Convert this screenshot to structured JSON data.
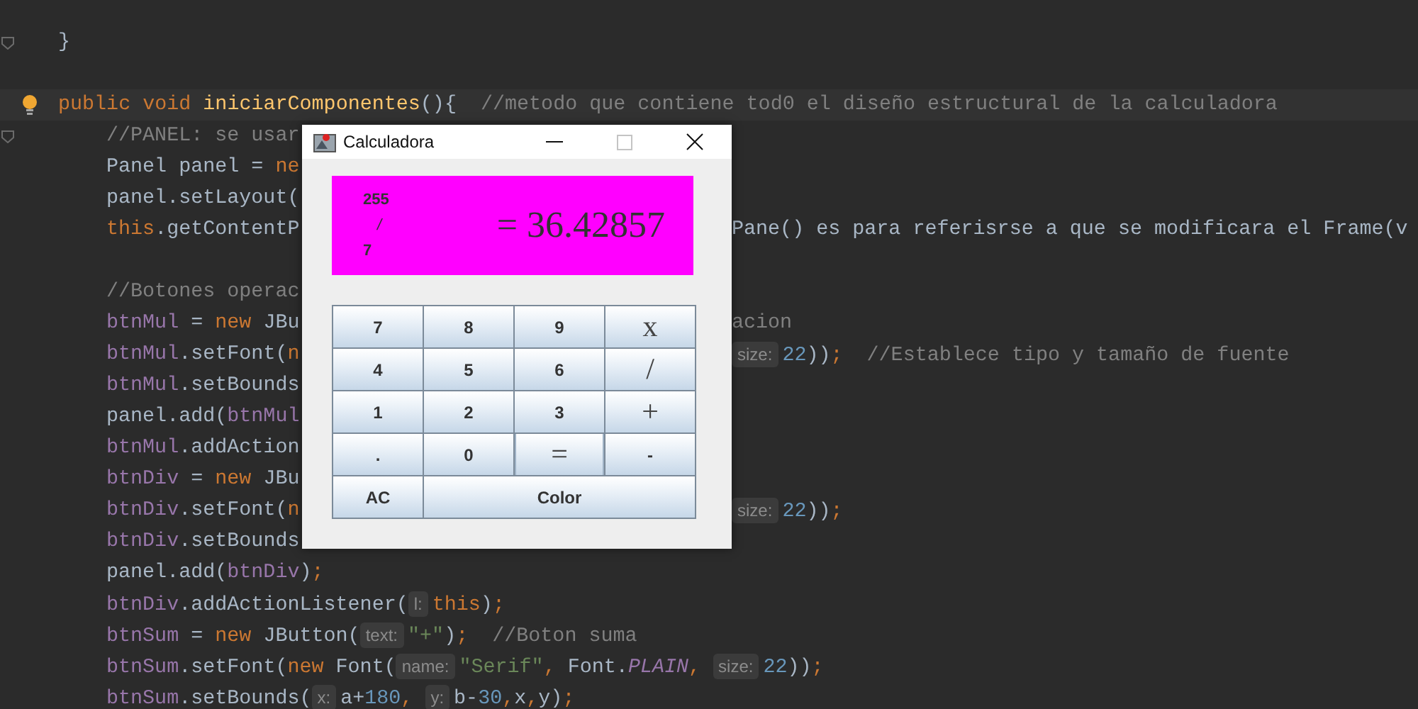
{
  "editor": {
    "lines": [
      {
        "kind": "blank"
      },
      {
        "kind": "code",
        "gutter": {
          "kind": "fold"
        },
        "segs": [
          {
            "kind": "plain",
            "t": "}"
          }
        ]
      },
      {
        "kind": "blank"
      },
      {
        "kind": "code",
        "current": true,
        "gutter": {
          "kind": "bulb"
        },
        "segs": [
          {
            "kind": "kw",
            "t": "public void "
          },
          {
            "kind": "method",
            "t": "iniciarComponentes"
          },
          {
            "kind": "plain",
            "t": "(){"
          },
          {
            "kind": "comment",
            "t": "//metodo que contiene tod0 el diseño estructural de la calculadora"
          }
        ],
        "children": [
          {
            "kind": "code",
            "gutter": {
              "kind": "fold"
            },
            "segs": [
              {
                "kind": "comment",
                "t": "//PANEL: se usar"
              }
            ]
          },
          {
            "kind": "code",
            "segs": [
              {
                "kind": "plain",
                "t": "Panel panel = "
              },
              {
                "kind": "kw",
                "t": "ne"
              }
            ]
          },
          {
            "kind": "code",
            "segs": [
              {
                "kind": "plain",
                "t": "panel.setLayout("
              }
            ]
          },
          {
            "kind": "code",
            "segs": [
              {
                "kind": "kw",
                "t": "this"
              },
              {
                "kind": "plain",
                "t": ".getContentP"
              }
            ],
            "right": [
              {
                "kind": "plain",
                "t": "Pane() es para referisrse a que se modificara el Frame(v"
              }
            ]
          },
          {
            "kind": "blank"
          },
          {
            "kind": "code",
            "segs": [
              {
                "kind": "comment",
                "t": "//Botones operac"
              }
            ]
          },
          {
            "kind": "code",
            "segs": [
              {
                "kind": "field",
                "t": "btnMul"
              },
              {
                "kind": "plain",
                "t": " = "
              },
              {
                "kind": "kw",
                "t": "new "
              },
              {
                "kind": "plain",
                "t": "JBu"
              }
            ],
            "right": [
              {
                "kind": "comment",
                "t": "acion"
              }
            ]
          },
          {
            "kind": "code",
            "segs": [
              {
                "kind": "field",
                "t": "btnMul"
              },
              {
                "kind": "plain",
                "t": ".setFont("
              },
              {
                "kind": "kw",
                "t": "n"
              }
            ],
            "right": [
              {
                "kind": "hint",
                "t": "size:"
              },
              {
                "kind": "num",
                "t": "22"
              },
              {
                "kind": "plain",
                "t": "))"
              },
              {
                "kind": "kw",
                "t": ";"
              },
              {
                "kind": "comment",
                "t": "//Establece tipo y tamaño de fuente"
              }
            ]
          },
          {
            "kind": "code",
            "segs": [
              {
                "kind": "field",
                "t": "btnMul"
              },
              {
                "kind": "plain",
                "t": ".setBounds"
              }
            ]
          },
          {
            "kind": "code",
            "segs": [
              {
                "kind": "plain",
                "t": "panel.add("
              },
              {
                "kind": "field",
                "t": "btnMul"
              }
            ]
          },
          {
            "kind": "code",
            "segs": [
              {
                "kind": "field",
                "t": "btnMul"
              },
              {
                "kind": "plain",
                "t": ".addAction"
              }
            ]
          },
          {
            "kind": "code",
            "segs": [
              {
                "kind": "field",
                "t": "btnDiv"
              },
              {
                "kind": "plain",
                "t": " = "
              },
              {
                "kind": "kw",
                "t": "new "
              },
              {
                "kind": "plain",
                "t": "JBu"
              }
            ]
          },
          {
            "kind": "code",
            "segs": [
              {
                "kind": "field",
                "t": "btnDiv"
              },
              {
                "kind": "plain",
                "t": ".setFont("
              },
              {
                "kind": "kw",
                "t": "n"
              }
            ],
            "right": [
              {
                "kind": "hint",
                "t": "size:"
              },
              {
                "kind": "num",
                "t": "22"
              },
              {
                "kind": "plain",
                "t": "))"
              },
              {
                "kind": "kw",
                "t": ";"
              }
            ]
          },
          {
            "kind": "code",
            "segs": [
              {
                "kind": "field",
                "t": "btnDiv"
              },
              {
                "kind": "plain",
                "t": ".setBounds"
              }
            ]
          },
          {
            "kind": "code",
            "segs": [
              {
                "kind": "plain",
                "t": "panel.add("
              },
              {
                "kind": "field",
                "t": "btnDiv"
              },
              {
                "kind": "plain",
                "t": ")"
              },
              {
                "kind": "kw",
                "t": ";"
              }
            ]
          },
          {
            "kind": "code",
            "segs": [
              {
                "kind": "field",
                "t": "btnDiv"
              },
              {
                "kind": "plain",
                "t": ".addActionListener("
              },
              {
                "kind": "hint",
                "t": "l:"
              },
              {
                "kind": "kw",
                "t": "this"
              },
              {
                "kind": "plain",
                "t": ")"
              },
              {
                "kind": "kw",
                "t": ";"
              }
            ]
          },
          {
            "kind": "code",
            "segs": [
              {
                "kind": "field",
                "t": "btnSum"
              },
              {
                "kind": "plain",
                "t": " = "
              },
              {
                "kind": "kw",
                "t": "new "
              },
              {
                "kind": "plain",
                "t": "JButton("
              },
              {
                "kind": "hint",
                "t": "text:"
              },
              {
                "kind": "str",
                "t": "\"+\""
              },
              {
                "kind": "plain",
                "t": ")"
              },
              {
                "kind": "kw",
                "t": ";"
              },
              {
                "kind": "comment",
                "t": "//Boton suma"
              }
            ]
          },
          {
            "kind": "code",
            "segs": [
              {
                "kind": "field",
                "t": "btnSum"
              },
              {
                "kind": "plain",
                "t": ".setFont("
              },
              {
                "kind": "kw",
                "t": "new "
              },
              {
                "kind": "plain",
                "t": "Font("
              },
              {
                "kind": "hint",
                "t": "name:"
              },
              {
                "kind": "str",
                "t": "\"Serif\""
              },
              {
                "kind": "kw",
                "t": ", "
              },
              {
                "kind": "plain",
                "t": "Font."
              },
              {
                "kind": "const",
                "t": "PLAIN"
              },
              {
                "kind": "kw",
                "t": ", "
              },
              {
                "kind": "hint",
                "t": "size:"
              },
              {
                "kind": "num",
                "t": "22"
              },
              {
                "kind": "plain",
                "t": "))"
              },
              {
                "kind": "kw",
                "t": ";"
              }
            ]
          },
          {
            "kind": "code",
            "segs": [
              {
                "kind": "field",
                "t": "btnSum"
              },
              {
                "kind": "plain",
                "t": ".setBounds("
              },
              {
                "kind": "hint",
                "t": "x:"
              },
              {
                "kind": "plain",
                "t": "a+"
              },
              {
                "kind": "num",
                "t": "180"
              },
              {
                "kind": "kw",
                "t": ", "
              },
              {
                "kind": "hint",
                "t": "y:"
              },
              {
                "kind": "plain",
                "t": "b-"
              },
              {
                "kind": "num",
                "t": "30"
              },
              {
                "kind": "kw",
                "t": ","
              },
              {
                "kind": "plain",
                "t": "x"
              },
              {
                "kind": "kw",
                "t": ","
              },
              {
                "kind": "plain",
                "t": "y)"
              },
              {
                "kind": "kw",
                "t": ";"
              }
            ]
          }
        ]
      }
    ]
  },
  "window": {
    "title": "Calculadora",
    "display": {
      "numerator": "255",
      "operator": "/",
      "denominator": "7",
      "result": "= 36.42857"
    },
    "buttons": [
      {
        "label": "7",
        "kind": "digit",
        "focused": false
      },
      {
        "label": "8",
        "kind": "digit",
        "focused": false
      },
      {
        "label": "9",
        "kind": "digit",
        "focused": false
      },
      {
        "label": "x",
        "kind": "symbol",
        "focused": false
      },
      {
        "label": "4",
        "kind": "digit",
        "focused": false
      },
      {
        "label": "5",
        "kind": "digit",
        "focused": false
      },
      {
        "label": "6",
        "kind": "digit",
        "focused": false
      },
      {
        "label": "/",
        "kind": "symbol",
        "focused": false
      },
      {
        "label": "1",
        "kind": "digit",
        "focused": false
      },
      {
        "label": "2",
        "kind": "digit",
        "focused": false
      },
      {
        "label": "3",
        "kind": "digit",
        "focused": false
      },
      {
        "label": "+",
        "kind": "symbol",
        "focused": false
      },
      {
        "label": ".",
        "kind": "digit",
        "focused": false
      },
      {
        "label": "0",
        "kind": "digit",
        "focused": false
      },
      {
        "label": "=",
        "kind": "symbol",
        "focused": true
      },
      {
        "label": "-",
        "kind": "digit",
        "focused": false
      },
      {
        "label": "AC",
        "kind": "digit",
        "focused": false
      },
      {
        "label": "Color",
        "kind": "wide",
        "focused": false
      }
    ]
  }
}
